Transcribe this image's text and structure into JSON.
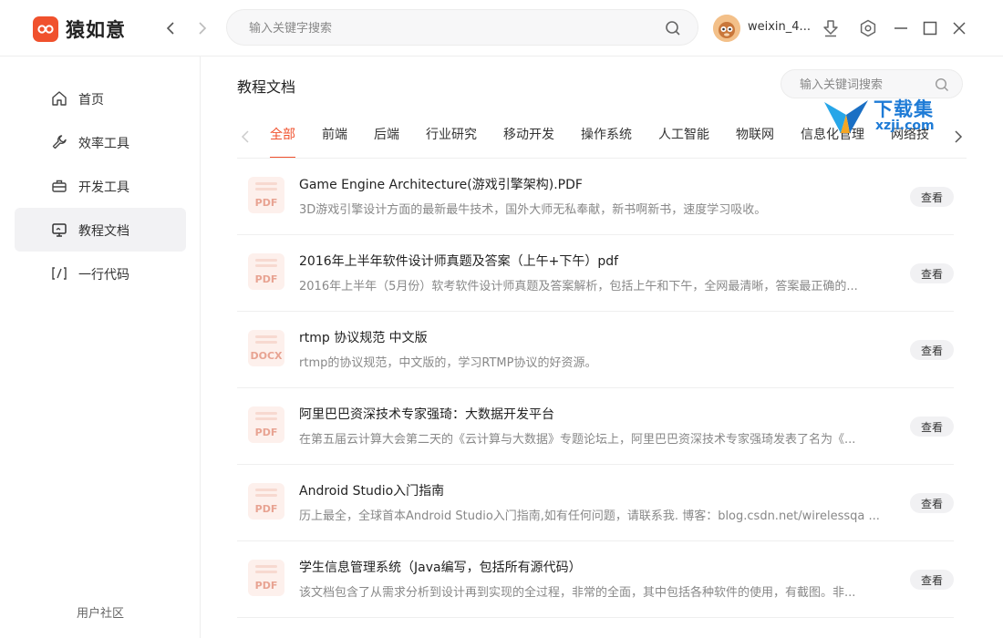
{
  "app": {
    "name": "猿如意",
    "brand_color": "#f0512d",
    "search_placeholder": "输入关键字搜索",
    "username": "weixin_4..."
  },
  "window_controls": [
    "download-icon",
    "settings-icon",
    "minimize-icon",
    "maximize-icon",
    "close-icon"
  ],
  "sidebar": {
    "items": [
      {
        "label": "首页",
        "icon": "home-icon",
        "active": false
      },
      {
        "label": "效率工具",
        "icon": "wrench-icon",
        "active": false
      },
      {
        "label": "开发工具",
        "icon": "toolbox-icon",
        "active": false
      },
      {
        "label": "教程文档",
        "icon": "document-icon",
        "active": true
      },
      {
        "label": "一行代码",
        "icon": "code-icon",
        "active": false
      }
    ],
    "community": "用户社区"
  },
  "main": {
    "title": "教程文档",
    "search_placeholder": "输入关键词搜索",
    "tabs": [
      "全部",
      "前端",
      "后端",
      "行业研究",
      "移动开发",
      "操作系统",
      "人工智能",
      "物联网",
      "信息化管理",
      "网络技"
    ],
    "active_tab": 0,
    "view_label": "查看",
    "documents": [
      {
        "ext": "PDF",
        "title": "Game Engine Architecture(游戏引擎架构).PDF",
        "desc": "3D游戏引擎设计方面的最新最牛技术，国外大师无私奉献，新书啊新书，速度学习吸收。"
      },
      {
        "ext": "PDF",
        "title": "2016年上半年软件设计师真题及答案（上午+下午）pdf",
        "desc": "2016年上半年（5月份）软考软件设计师真题及答案解析，包括上午和下午，全网最清晰，答案最正确的..."
      },
      {
        "ext": "DOCX",
        "title": "rtmp 协议规范 中文版",
        "desc": "rtmp的协议规范，中文版的，学习RTMP协议的好资源。"
      },
      {
        "ext": "PDF",
        "title": "阿里巴巴资深技术专家强琦：大数据开发平台",
        "desc": "在第五届云计算大会第二天的《云计算与大数据》专题论坛上，阿里巴巴资深技术专家强琦发表了名为《..."
      },
      {
        "ext": "PDF",
        "title": "Android Studio入门指南",
        "desc": "历上最全，全球首本Android Studio入门指南,如有任何问题，请联系我. 博客：blog.csdn.net/wirelessqa ..."
      },
      {
        "ext": "PDF",
        "title": "学生信息管理系统（Java编写，包括所有源代码）",
        "desc": "该文档包含了从需求分析到设计再到实现的全过程，非常的全面，其中包括各种软件的使用，有截图。非..."
      }
    ]
  },
  "watermark": {
    "text": "下载集",
    "sub": "xzji.com"
  }
}
